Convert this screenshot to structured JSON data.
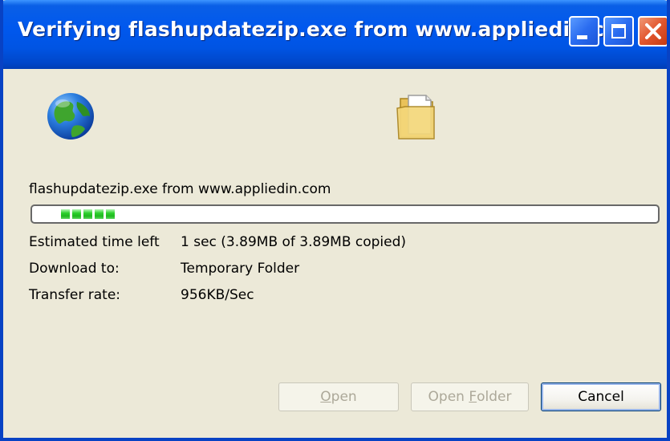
{
  "window": {
    "title": "Verifying flashupdatezip.exe from www.appliedin.c..."
  },
  "icons": {
    "globe": "globe-icon",
    "folder": "folder-icon",
    "minimize": "minimize-icon",
    "maximize": "maximize-icon",
    "close": "close-icon"
  },
  "download": {
    "file_label": "flashupdatezip.exe from www.appliedin.com",
    "progress_fraction": 0.1,
    "progress_segments": 5,
    "rows": [
      {
        "label": "Estimated time left",
        "value": "1 sec (3.89MB of 3.89MB copied)"
      },
      {
        "label": "Download to:",
        "value": "Temporary Folder"
      },
      {
        "label": "Transfer rate:",
        "value": "956KB/Sec"
      }
    ]
  },
  "buttons": {
    "open": {
      "pre": "",
      "accel": "O",
      "post": "pen",
      "enabled": false
    },
    "open_folder": {
      "pre": "Open ",
      "accel": "F",
      "post": "older",
      "enabled": false
    },
    "cancel": {
      "label": "Cancel",
      "enabled": true
    }
  },
  "colors": {
    "titlebar": "#0054E3",
    "face": "#ECE9D8",
    "progress": "#2BD02B",
    "close_button": "#E2562E"
  }
}
